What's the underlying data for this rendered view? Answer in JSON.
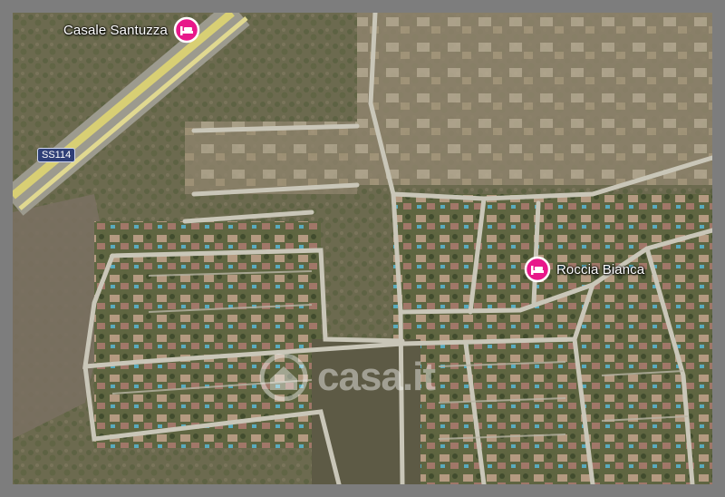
{
  "map": {
    "road_label": "SS114",
    "places": [
      {
        "name": "Casale Santuzza",
        "icon": "bed-icon"
      },
      {
        "name": "Roccia Bianca",
        "icon": "bed-icon"
      }
    ],
    "watermark": {
      "text": "casa.it",
      "icon": "house-icon"
    },
    "colors": {
      "pin": "#e8188a",
      "frame": "#7d7d7d",
      "road": "#c9c6b8",
      "highway": "#d8cf74"
    }
  }
}
